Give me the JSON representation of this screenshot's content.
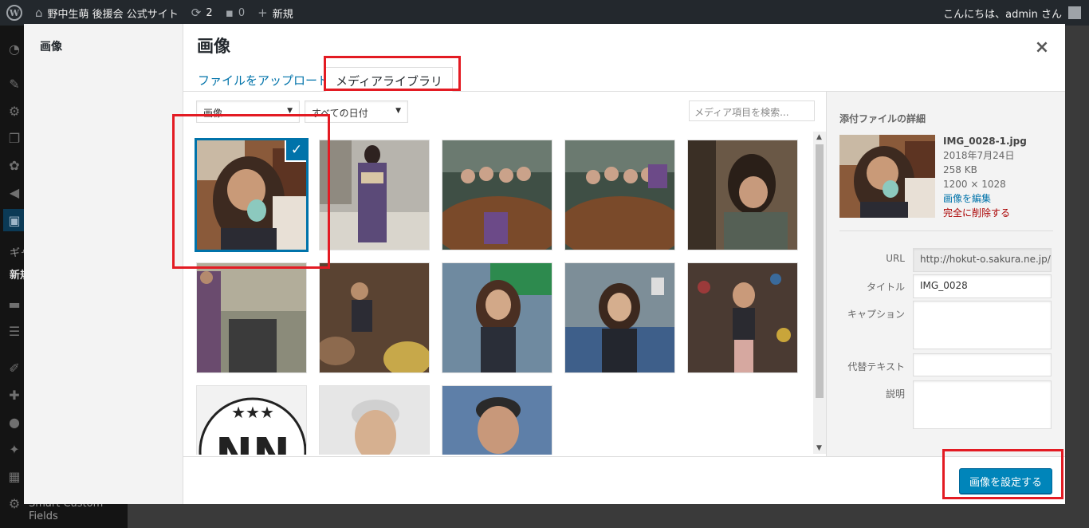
{
  "admin_bar": {
    "site_name": "野中生萌 後援会 公式サイト",
    "updates_count": "2",
    "comments_count": "0",
    "new_label": "新規",
    "greeting": "こんにちは、admin さん"
  },
  "admin_menu": {
    "gallery_partial": "ギャ",
    "new_partial": "新規",
    "plugin_label_1": "Smart Custom",
    "plugin_label_2": "Fields"
  },
  "modal": {
    "menu_item": "画像",
    "title": "画像",
    "close_symbol": "×",
    "tabs": {
      "upload": "ファイルをアップロード",
      "library": "メディアライブラリ"
    },
    "filters": {
      "type_selected": "画像",
      "date_selected": "すべての日付",
      "search_placeholder": "メディア項目を検索..."
    },
    "attachments": [
      {
        "id": "img-1",
        "selected": true
      },
      {
        "id": "img-2",
        "selected": false
      },
      {
        "id": "img-3",
        "selected": false
      },
      {
        "id": "img-4",
        "selected": false
      },
      {
        "id": "img-5",
        "selected": false
      },
      {
        "id": "img-6",
        "selected": false
      },
      {
        "id": "img-7",
        "selected": false
      },
      {
        "id": "img-8",
        "selected": false
      },
      {
        "id": "img-9",
        "selected": false
      },
      {
        "id": "img-10",
        "selected": false
      },
      {
        "id": "img-11",
        "selected": false
      },
      {
        "id": "img-12",
        "selected": false
      },
      {
        "id": "img-13",
        "selected": false
      }
    ],
    "details": {
      "heading": "添付ファイルの詳細",
      "filename": "IMG_0028-1.jpg",
      "date": "2018年7月24日",
      "filesize": "258 KB",
      "dimensions": "1200 × 1028",
      "edit_link": "画像を編集",
      "delete_link": "完全に削除する",
      "url_label": "URL",
      "url_value": "http://hokut-o.sakura.ne.jp/w",
      "title_label": "タイトル",
      "title_value": "IMG_0028",
      "caption_label": "キャプション",
      "alt_label": "代替テキスト",
      "description_label": "説明"
    },
    "set_button": "画像を設定する"
  },
  "colors": {
    "accent": "#0073aa",
    "button": "#0085ba",
    "highlight": "#e31b23",
    "delete": "#a00000"
  }
}
